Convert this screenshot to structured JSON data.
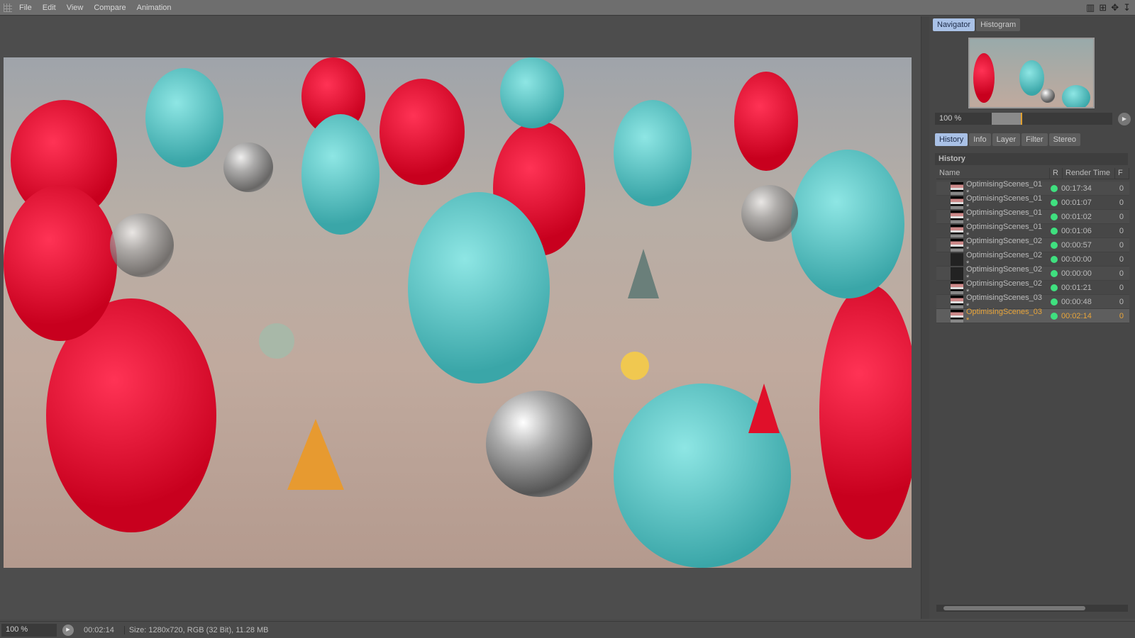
{
  "menu": [
    "File",
    "Edit",
    "View",
    "Compare",
    "Animation"
  ],
  "navigator": {
    "tabs": [
      "Navigator",
      "Histogram"
    ],
    "zoom": "100 %",
    "slider_fraction": 0.25
  },
  "lower_tabs": [
    "History",
    "Info",
    "Layer",
    "Filter",
    "Stereo"
  ],
  "history": {
    "title": "History",
    "columns": [
      "Name",
      "R",
      "Render Time",
      "F"
    ],
    "rows": [
      {
        "name": "OptimisingScenes_01 *",
        "time": "00:17:34",
        "f": "0"
      },
      {
        "name": "OptimisingScenes_01 *",
        "time": "00:01:07",
        "f": "0"
      },
      {
        "name": "OptimisingScenes_01 *",
        "time": "00:01:02",
        "f": "0"
      },
      {
        "name": "OptimisingScenes_01 *",
        "time": "00:01:06",
        "f": "0"
      },
      {
        "name": "OptimisingScenes_02 *",
        "time": "00:00:57",
        "f": "0"
      },
      {
        "name": "OptimisingScenes_02 *",
        "time": "00:00:00",
        "f": "0"
      },
      {
        "name": "OptimisingScenes_02 *",
        "time": "00:00:00",
        "f": "0"
      },
      {
        "name": "OptimisingScenes_02 *",
        "time": "00:01:21",
        "f": "0"
      },
      {
        "name": "OptimisingScenes_03 *",
        "time": "00:00:48",
        "f": "0"
      },
      {
        "name": "OptimisingScenes_03 *",
        "time": "00:02:14",
        "f": "0"
      }
    ],
    "selected_index": 9
  },
  "status": {
    "zoom": "100 %",
    "time": "00:02:14",
    "size": "Size: 1280x720, RGB (32 Bit), 11.28 MB"
  },
  "colors": {
    "accent": "#e9a53a",
    "status_ok": "#3fe07f",
    "tab_active": "#a9c1e6"
  }
}
